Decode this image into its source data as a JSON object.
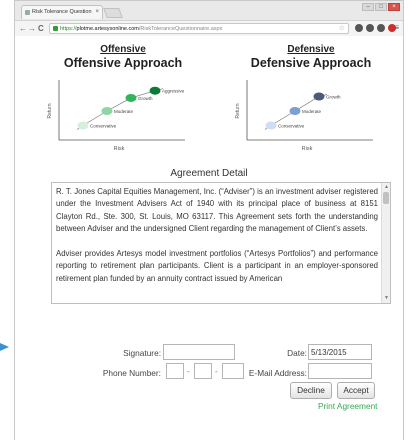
{
  "browser": {
    "tab_title": "Risk Tolerance Question",
    "tab_close": "×",
    "url_scheme": "https://",
    "url_host": "plotme.artesysonline.com",
    "url_path": "/RiskToleranceQuestionnaire.aspx",
    "back": "←",
    "forward": "→",
    "reload": "C",
    "star": "☆",
    "menu": "≡",
    "minimize": "–",
    "maximize": "□",
    "close": "×"
  },
  "offensive": {
    "heading": "Offensive",
    "title": "Offensive Approach",
    "chart_data": {
      "type": "line",
      "title": "Offensive Approach",
      "xlabel": "Risk",
      "ylabel": "Return",
      "points": [
        {
          "label": "Conservative",
          "x": 1,
          "y": 1,
          "color": "#d6efdc"
        },
        {
          "label": "Moderate",
          "x": 2,
          "y": 2,
          "color": "#8fd6a3"
        },
        {
          "label": "Growth",
          "x": 3,
          "y": 2.9,
          "color": "#31b45a"
        },
        {
          "label": "Aggressive",
          "x": 4,
          "y": 3.4,
          "color": "#0d7a3a"
        }
      ]
    }
  },
  "defensive": {
    "heading": "Defensive",
    "title": "Defensive Approach",
    "chart_data": {
      "type": "line",
      "title": "Defensive Approach",
      "xlabel": "Risk",
      "ylabel": "Return",
      "points": [
        {
          "label": "Conservative",
          "x": 1,
          "y": 1,
          "color": "#cfdff3"
        },
        {
          "label": "Moderate",
          "x": 2,
          "y": 2,
          "color": "#7d9fd2"
        },
        {
          "label": "Growth",
          "x": 3,
          "y": 3,
          "color": "#4a5a78"
        }
      ]
    }
  },
  "agreement": {
    "title": "Agreement Detail",
    "paragraphs": [
      "R. T. Jones Capital Equities Management, Inc. (“Adviser”) is an investment adviser registered under the Investment Advisers Act of 1940 with its principal place of business at 8151 Clayton Rd., Ste. 300, St. Louis, MO 63117. This Agreement sets forth the understanding between Adviser and the undersigned Client regarding the management of Client’s assets.",
      "Adviser provides Artesys model investment portfolios (“Artesys Portfolios”) and performance reporting to retirement plan participants. Client is a participant in an employer-sponsored retirement plan funded by an annuity contract issued by American"
    ]
  },
  "form": {
    "signature_label": "Signature:",
    "signature_value": "",
    "phone_label": "Phone Number:",
    "phone_dash": "-",
    "date_label": "Date:",
    "date_value": "5/13/2015",
    "email_label": "E-Mail Address:",
    "email_value": "",
    "decline_label": "Decline",
    "accept_label": "Accept",
    "print_label": "Print Agreement"
  }
}
